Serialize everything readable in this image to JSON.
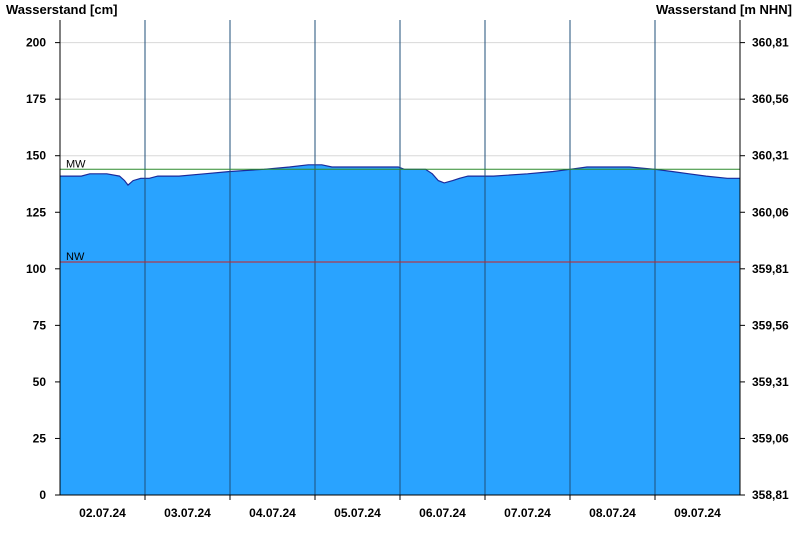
{
  "chart_data": {
    "type": "area",
    "y_left_label": "Wasserstand [cm]",
    "y_right_label": "Wasserstand [m NHN]",
    "ylim": [
      0,
      210
    ],
    "y_ticks": [
      0,
      25,
      50,
      75,
      100,
      125,
      150,
      175,
      200
    ],
    "y_right_ticks": [
      "358,81",
      "359,06",
      "359,31",
      "359,56",
      "359,81",
      "360,06",
      "360,31",
      "360,56",
      "360,81"
    ],
    "x_range_days": [
      0,
      8
    ],
    "x_tick_labels": [
      "02.07.24",
      "03.07.24",
      "04.07.24",
      "05.07.24",
      "06.07.24",
      "07.07.24",
      "08.07.24",
      "09.07.24"
    ],
    "reference_lines": [
      {
        "name": "MW",
        "value": 144,
        "color": "#2e8b2e"
      },
      {
        "name": "NW",
        "value": 103,
        "color": "#cc2222"
      }
    ],
    "series": [
      {
        "color": "#29a3ff",
        "points": [
          [
            0.0,
            141
          ],
          [
            0.25,
            141
          ],
          [
            0.35,
            142
          ],
          [
            0.45,
            142
          ],
          [
            0.55,
            142
          ],
          [
            0.7,
            141
          ],
          [
            0.76,
            139
          ],
          [
            0.8,
            137
          ],
          [
            0.86,
            139
          ],
          [
            0.95,
            140
          ],
          [
            1.05,
            140
          ],
          [
            1.15,
            141
          ],
          [
            1.4,
            141
          ],
          [
            1.7,
            142
          ],
          [
            2.0,
            143
          ],
          [
            2.4,
            144
          ],
          [
            2.7,
            145
          ],
          [
            2.92,
            146
          ],
          [
            3.08,
            146
          ],
          [
            3.2,
            145
          ],
          [
            3.5,
            145
          ],
          [
            3.98,
            145
          ],
          [
            4.05,
            144
          ],
          [
            4.3,
            144
          ],
          [
            4.38,
            142
          ],
          [
            4.45,
            139
          ],
          [
            4.52,
            138
          ],
          [
            4.62,
            139
          ],
          [
            4.7,
            140
          ],
          [
            4.8,
            141
          ],
          [
            5.1,
            141
          ],
          [
            5.5,
            142
          ],
          [
            5.8,
            143
          ],
          [
            6.0,
            144
          ],
          [
            6.2,
            145
          ],
          [
            6.7,
            145
          ],
          [
            7.0,
            144
          ],
          [
            7.2,
            143
          ],
          [
            7.4,
            142
          ],
          [
            7.6,
            141
          ],
          [
            7.85,
            140
          ],
          [
            8.0,
            140
          ]
        ]
      }
    ]
  }
}
